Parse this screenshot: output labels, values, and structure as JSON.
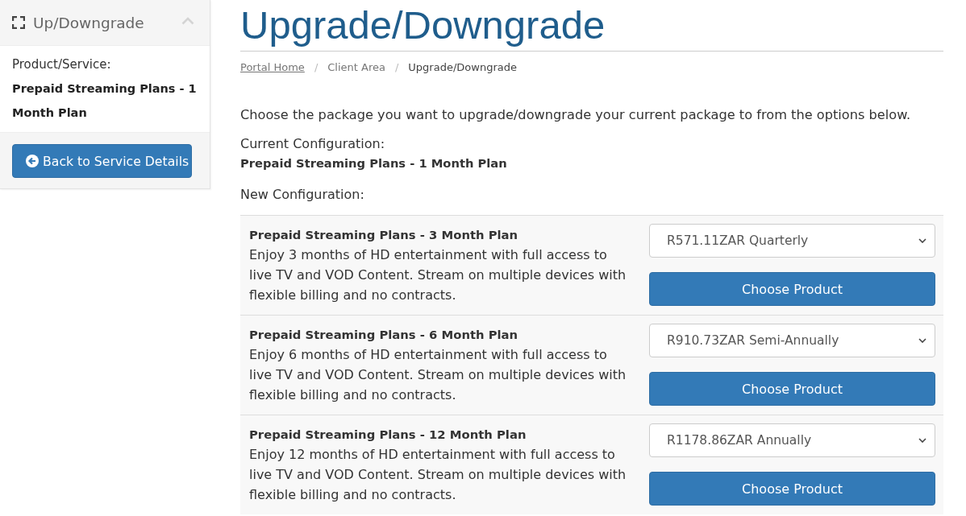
{
  "sidebar": {
    "title": "Up/Downgrade",
    "expanded": true,
    "label": "Product/Service:",
    "product": "Prepaid Streaming Plans - 1 Month Plan",
    "back_button": "Back to Service Details"
  },
  "page": {
    "title": "Upgrade/Downgrade",
    "breadcrumb": [
      {
        "label": "Portal Home",
        "kind": "link",
        "hovered": true
      },
      {
        "label": "/",
        "kind": "separator",
        "hovered": false
      },
      {
        "label": "Client Area",
        "kind": "link",
        "hovered": false
      },
      {
        "label": "/",
        "kind": "separator",
        "hovered": false
      },
      {
        "label": "Upgrade/Downgrade",
        "kind": "active",
        "hovered": false
      }
    ],
    "intro": "Choose the package you want to upgrade/downgrade your current package to from the options below.",
    "current_configuration": {
      "label": "Current Configuration:",
      "value": "Prepaid Streaming Plans - 1 Month Plan"
    },
    "new_configuration_label": "New Configuration:",
    "options": [
      {
        "name": "Prepaid Streaming Plans - 3 Month Plan",
        "description": "Enjoy 3 months of HD entertainment with full access to live TV and VOD Content. Stream on multiple devices with flexible billing and no contracts.",
        "billing_cycle": "R571.11ZAR Quarterly",
        "button": "Choose Product"
      },
      {
        "name": "Prepaid Streaming Plans - 6 Month Plan",
        "description": "Enjoy 6 months of HD entertainment with full access to live TV and VOD Content. Stream on multiple devices with flexible billing and no contracts.",
        "billing_cycle": "R910.73ZAR Semi-Annually",
        "button": "Choose Product"
      },
      {
        "name": "Prepaid Streaming Plans - 12 Month Plan",
        "description": "Enjoy 12 months of HD entertainment with full access to live TV and VOD Content. Stream on multiple devices with flexible billing and no contracts.",
        "billing_cycle": "R1178.86ZAR Annually",
        "button": "Choose Product"
      }
    ]
  }
}
